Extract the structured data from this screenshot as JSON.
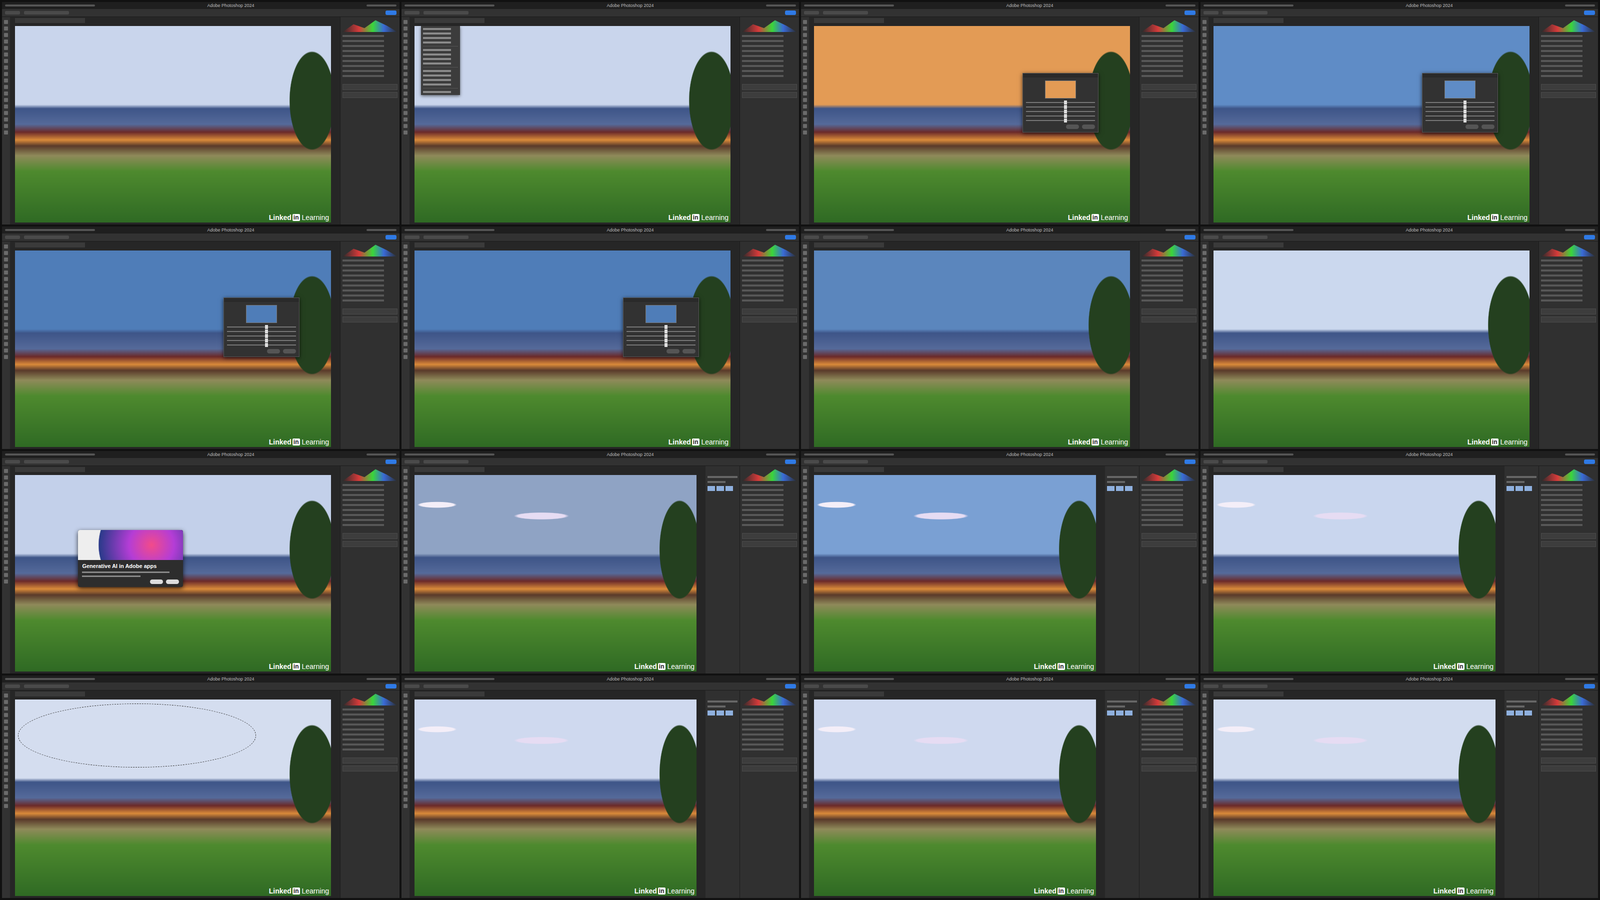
{
  "app_title": "Adobe Photoshop 2024",
  "watermark": {
    "brand": "Linked",
    "badge": "in",
    "product": "Learning"
  },
  "genai_dialog": {
    "title": "Generative AI in Adobe apps"
  },
  "frames": [
    {
      "kind": "plain",
      "color": "#c9d5ec"
    },
    {
      "kind": "menu",
      "color": "#c9d5ec"
    },
    {
      "kind": "sky-dialog",
      "color": "#e39b55"
    },
    {
      "kind": "sky-dialog",
      "color": "#5f8cc6"
    },
    {
      "kind": "sky-dialog",
      "color": "#4f7db8"
    },
    {
      "kind": "sky-dialog",
      "color": "#4f7db8"
    },
    {
      "kind": "plain",
      "color": "#5b86bd"
    },
    {
      "kind": "plain",
      "color": "#cbd8ee"
    },
    {
      "kind": "genai-dialog",
      "color": "#c3d0ea"
    },
    {
      "kind": "clouds",
      "color": "#8fa3c4"
    },
    {
      "kind": "clouds",
      "color": "#7aa0d3"
    },
    {
      "kind": "clouds",
      "color": "#c9d6ee"
    },
    {
      "kind": "selection",
      "color": "#d4ddef"
    },
    {
      "kind": "clouds",
      "color": "#cfd9ef"
    },
    {
      "kind": "clouds",
      "color": "#cfd9ef"
    },
    {
      "kind": "clouds",
      "color": "#d2dcef"
    }
  ]
}
